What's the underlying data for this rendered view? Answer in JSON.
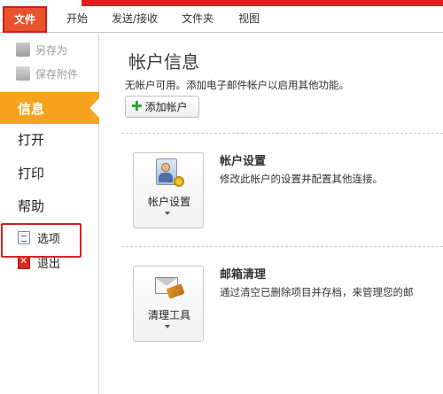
{
  "ribbon": {
    "tabs": [
      {
        "label": "文件"
      },
      {
        "label": "开始"
      },
      {
        "label": "发送/接收"
      },
      {
        "label": "文件夹"
      },
      {
        "label": "视图"
      }
    ]
  },
  "backstage": {
    "quick": [
      {
        "label": "另存为",
        "icon": "save-as-icon"
      },
      {
        "label": "保存附件",
        "icon": "save-attachment-icon"
      }
    ],
    "info_label": "信息",
    "open_label": "打开",
    "print_label": "打印",
    "help_label": "帮助",
    "options_label": "选项",
    "exit_label": "退出"
  },
  "info": {
    "title": "帐户信息",
    "desc": "无帐户可用。添加电子邮件帐户以启用其他功能。",
    "add_account_label": "添加帐户",
    "account_settings": {
      "button_label": "帐户设置",
      "title": "帐户设置",
      "desc": "修改此帐户的设置并配置其他连接。"
    },
    "mailbox_cleanup": {
      "button_label": "清理工具",
      "title": "邮箱清理",
      "desc": "通过清空已删除项目并存档，来管理您的邮"
    }
  },
  "colors": {
    "file_tab": "#e8532b",
    "selected_nav": "#f6a21e",
    "annotation_red": "#d42222"
  }
}
